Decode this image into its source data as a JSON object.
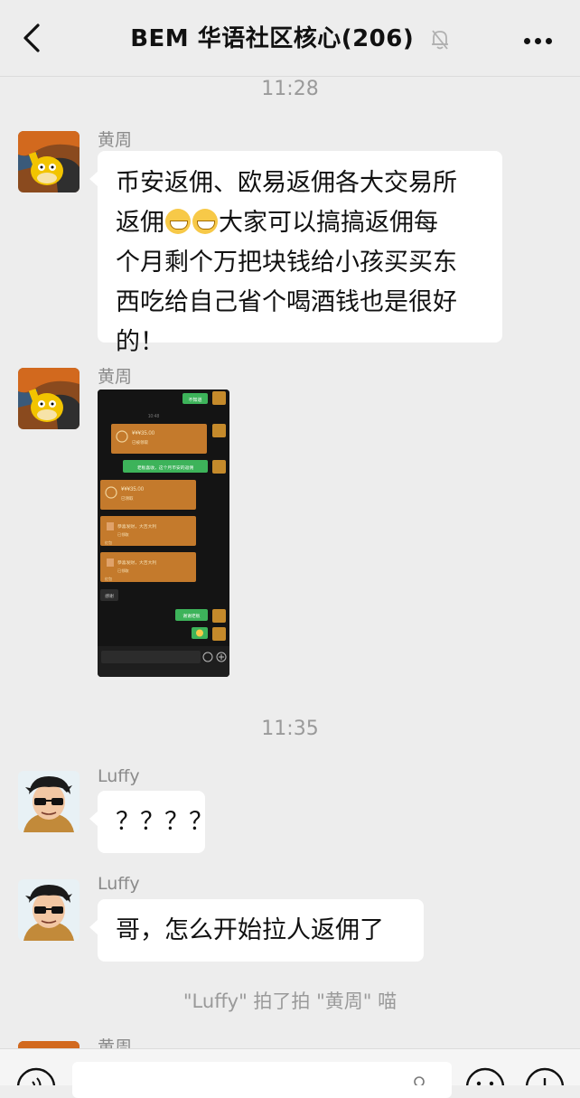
{
  "header": {
    "title": "BEM 华语社区核心(206)",
    "back_icon": "chevron-left-icon",
    "mute_icon": "bell-off-icon",
    "more_icon": "more-dots-icon"
  },
  "messages": [
    {
      "type": "time",
      "text": "11:28"
    },
    {
      "type": "text",
      "sender": "黄周",
      "lines": [
        "币安返佣、欧易返佣各大交易所",
        {
          "before": "返佣",
          "emojis": 2,
          "after": "大家可以搞搞返佣每"
        },
        "个月剩个万把块钱给小孩买买东",
        "西吃给自己省个喝酒钱也是很好",
        "的！"
      ]
    },
    {
      "type": "image",
      "sender": "黄周",
      "screenshot": {
        "time": "10:48",
        "bubbles": {
          "b1": "不知道",
          "red1_amount": "¥¥¥35.00",
          "red1_sub": "已被领取",
          "b2": "老板喜收，这个月币安的返佣",
          "red2_amount": "¥¥¥35.00",
          "red2_sub": "已领取",
          "red3_text": "恭喜发财，大吉大利",
          "red3_sub": "已领取",
          "red3_foot": "红包",
          "red4_text": "恭喜发财，大吉大利",
          "red4_sub": "已领取",
          "red4_foot": "红包",
          "b3": "感谢",
          "b4": "谢谢老板"
        }
      }
    },
    {
      "type": "time",
      "text": "11:35"
    },
    {
      "type": "text",
      "sender": "Luffy",
      "text": "？？？？"
    },
    {
      "type": "text",
      "sender": "Luffy",
      "text": "哥，怎么开始拉人返佣了"
    },
    {
      "type": "system",
      "text": "\"Luffy\" 拍了拍 \"黄周\" 喵"
    },
    {
      "type": "partial",
      "sender": "黄周"
    }
  ],
  "input_bar": {
    "voice_icon": "voice-icon",
    "emoji_icon": "emoji-icon",
    "add_icon": "plus-icon"
  }
}
